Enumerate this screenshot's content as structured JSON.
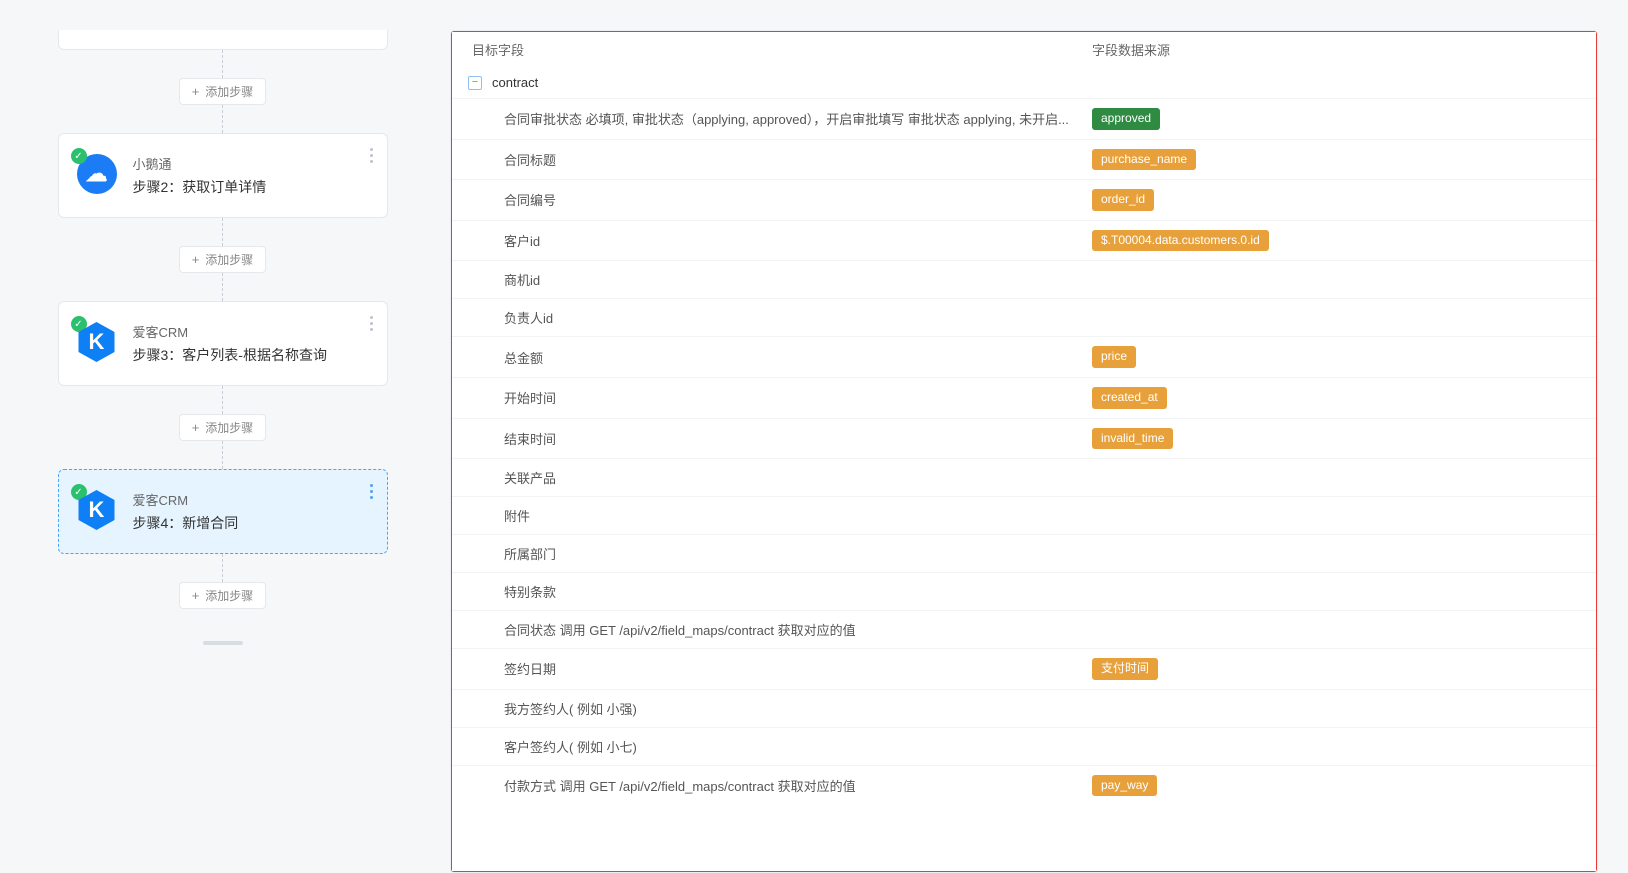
{
  "addStepLabel": "添加步骤",
  "steps": [
    {
      "appName": "小鹅通",
      "title": "步骤2：获取订单详情",
      "iconType": "blue-circle",
      "iconGlyph": "☁",
      "selected": false
    },
    {
      "appName": "爱客CRM",
      "title": "步骤3：客户列表-根据名称查询",
      "iconType": "blue-hex",
      "iconGlyph": "K",
      "selected": false
    },
    {
      "appName": "爱客CRM",
      "title": "步骤4：新增合同",
      "iconType": "blue-hex",
      "iconGlyph": "K",
      "selected": true
    }
  ],
  "mapping": {
    "headerTarget": "目标字段",
    "headerSource": "字段数据来源",
    "rootName": "contract",
    "fields": [
      {
        "label": "合同审批状态 必填项, 审批状态（applying, approved），开启审批填写 审批状态 applying, 未开启...",
        "source": "approved",
        "color": "green"
      },
      {
        "label": "合同标题",
        "source": "purchase_name",
        "color": "orange"
      },
      {
        "label": "合同编号",
        "source": "order_id",
        "color": "orange"
      },
      {
        "label": "客户id",
        "source": "$.T00004.data.customers.0.id",
        "color": "orange"
      },
      {
        "label": "商机id",
        "source": "",
        "color": ""
      },
      {
        "label": "负责人id",
        "source": "",
        "color": ""
      },
      {
        "label": "总金额",
        "source": "price",
        "color": "orange"
      },
      {
        "label": "开始时间",
        "source": "created_at",
        "color": "orange"
      },
      {
        "label": "结束时间",
        "source": "invalid_time",
        "color": "orange"
      },
      {
        "label": "关联产品",
        "source": "",
        "color": ""
      },
      {
        "label": "附件",
        "source": "",
        "color": ""
      },
      {
        "label": "所属部门",
        "source": "",
        "color": ""
      },
      {
        "label": "特别条款",
        "source": "",
        "color": ""
      },
      {
        "label": "合同状态 调用 GET /api/v2/field_maps/contract 获取对应的值",
        "source": "",
        "color": ""
      },
      {
        "label": "签约日期",
        "source": "支付时间",
        "color": "orange"
      },
      {
        "label": "我方签约人( 例如 小强)",
        "source": "",
        "color": ""
      },
      {
        "label": "客户签约人( 例如 小七)",
        "source": "",
        "color": ""
      },
      {
        "label": "付款方式 调用 GET /api/v2/field_maps/contract 获取对应的值",
        "source": "pay_way",
        "color": "orange"
      }
    ]
  }
}
